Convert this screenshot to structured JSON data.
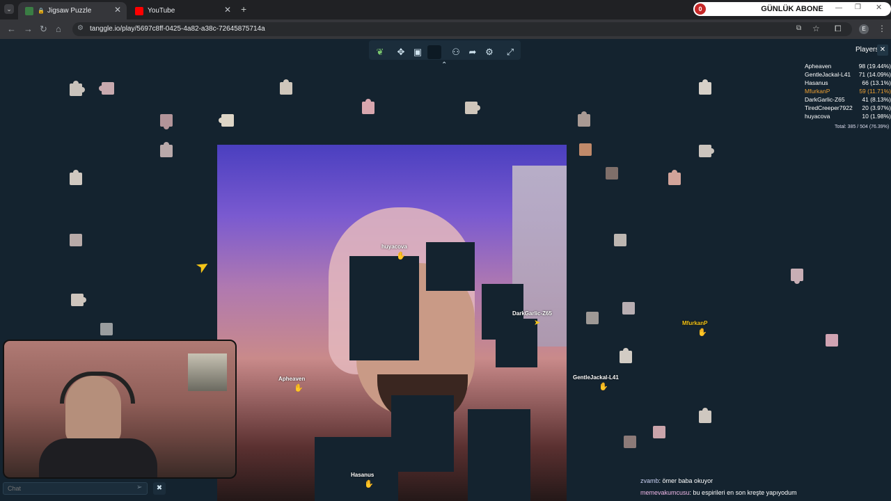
{
  "browser": {
    "tabs": [
      {
        "title": "Jigsaw Puzzle",
        "active": true
      },
      {
        "title": "YouTube",
        "active": false
      }
    ],
    "url": "tanggle.io/play/5697c8ff-0425-4a82-a38c-72645875714a",
    "subscriber_widget": {
      "count": "0",
      "label": "GÜNLÜK ABONE"
    },
    "profile_initial": "E"
  },
  "colors": {
    "accent": "#f5c518",
    "highlight_player": "#f0a030",
    "bg": "#14232f"
  },
  "toolbar_icons": [
    "leaf-logo-icon",
    "puzzle-icon",
    "image-icon",
    "square-icon",
    "users-icon",
    "share-icon",
    "gear-icon",
    "fullscreen-icon"
  ],
  "players_panel": {
    "title": "Players",
    "rows": [
      {
        "name": "Apheaven",
        "score": "98 (19.44%)"
      },
      {
        "name": "GentleJackal-L41",
        "score": "71 (14.09%)"
      },
      {
        "name": "Hasanus",
        "score": "66 (13.1%)"
      },
      {
        "name": "MfurkanP",
        "score": "59 (11.71%)",
        "highlight": true
      },
      {
        "name": "DarkGarlic-Z65",
        "score": "41 (8.13%)"
      },
      {
        "name": "TiredCreeper7922",
        "score": "20 (3.97%)"
      },
      {
        "name": "huyacova",
        "score": "10 (1.98%)"
      }
    ],
    "total": "Total: 385 / 504 (76.39%)"
  },
  "cursors": {
    "huyacova": "huyacova",
    "darkgarlic": "DarkGarlic-Z65",
    "mfurkanp": "MfurkanP",
    "gentlejackal": "GentleJackal-L41",
    "apheaven": "Apheaven",
    "hasanus": "Hasanus"
  },
  "chat": {
    "placeholder": "Chat",
    "messages": [
      {
        "user": "zvamb",
        "text": "ömer baba okuyor"
      },
      {
        "user": "memevakumcusu",
        "text": "bu espirileri en son kreşte yapıyodum"
      }
    ]
  }
}
